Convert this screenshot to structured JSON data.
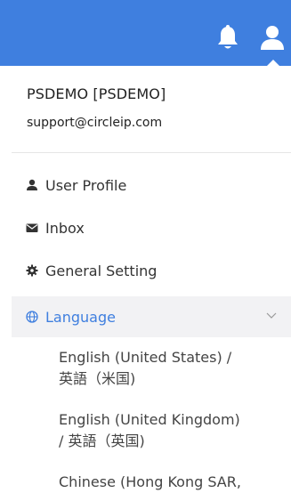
{
  "header": {
    "notifications_icon": "bell-icon",
    "user_icon": "user-icon",
    "background_color": "#3f7fdf"
  },
  "account": {
    "name": "PSDEMO [PSDEMO]",
    "email": "support@circleip.com"
  },
  "menu": {
    "items": [
      {
        "label": "User Profile",
        "icon": "user-icon"
      },
      {
        "label": "Inbox",
        "icon": "envelope-icon"
      },
      {
        "label": "General Setting",
        "icon": "gear-icon"
      },
      {
        "label": "Language",
        "icon": "globe-icon",
        "active": true
      }
    ],
    "accent_color": "#3f7fdf"
  },
  "language_options": [
    {
      "line1": "English (United States) /",
      "line2": "英語（米国)"
    },
    {
      "line1": "English (United Kingdom)",
      "line2": "/ 英語（英国)"
    },
    {
      "line1": "Chinese (Hong Kong SAR,",
      "line2": ""
    }
  ]
}
